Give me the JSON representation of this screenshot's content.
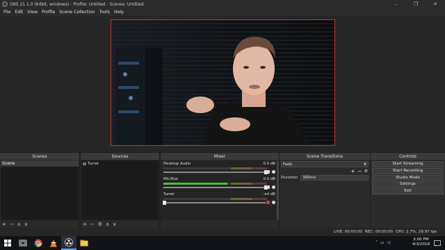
{
  "window": {
    "title": "OBS 21.1.0 (64bit, windows) - Profile: Untitled - Scenes: Untitled",
    "controls": [
      "–",
      "❐",
      "✕"
    ]
  },
  "menu": [
    "File",
    "Edit",
    "View",
    "Profile",
    "Scene Collection",
    "Tools",
    "Help"
  ],
  "docks": {
    "scenes": {
      "title": "Scenes",
      "items": [
        "Scene"
      ],
      "footer": [
        "+",
        "−",
        "∧",
        "∨"
      ]
    },
    "sources": {
      "title": "Sources",
      "items": [
        "Turret"
      ],
      "footer": [
        "+",
        "−",
        "⚙",
        "∧",
        "∨"
      ]
    },
    "mixer": {
      "title": "Mixer",
      "tracks": [
        {
          "name": "Desktop Audio",
          "db": "0.0 dB",
          "level": 0.0,
          "volume": 1.0
        },
        {
          "name": "Mic/Aux",
          "db": "0.0 dB",
          "level": 0.62,
          "volume": 1.0
        },
        {
          "name": "Turret",
          "db": "-inf dB",
          "level": 0.0,
          "volume": 0.0
        }
      ]
    },
    "transitions": {
      "title": "Scene Transitions",
      "selected": "Fade",
      "duration_label": "Duration",
      "duration_value": "300ms"
    },
    "controls": {
      "title": "Controls",
      "buttons": [
        "Start Streaming",
        "Start Recording",
        "Studio Mode",
        "Settings",
        "Exit"
      ]
    }
  },
  "status": {
    "live": "LIVE: 00:00:00",
    "rec": "REC: 00:00:00",
    "cpu": "CPU: 2.7%, 29.97 fps"
  },
  "taskbar": {
    "time": "3:00 PM",
    "date": "4/3/2018"
  },
  "colors": {
    "preview_border": "#b03a3a",
    "meter_green": "#4fbf3a",
    "meter_yellow": "#c6b430",
    "meter_red": "#b33a3a"
  }
}
